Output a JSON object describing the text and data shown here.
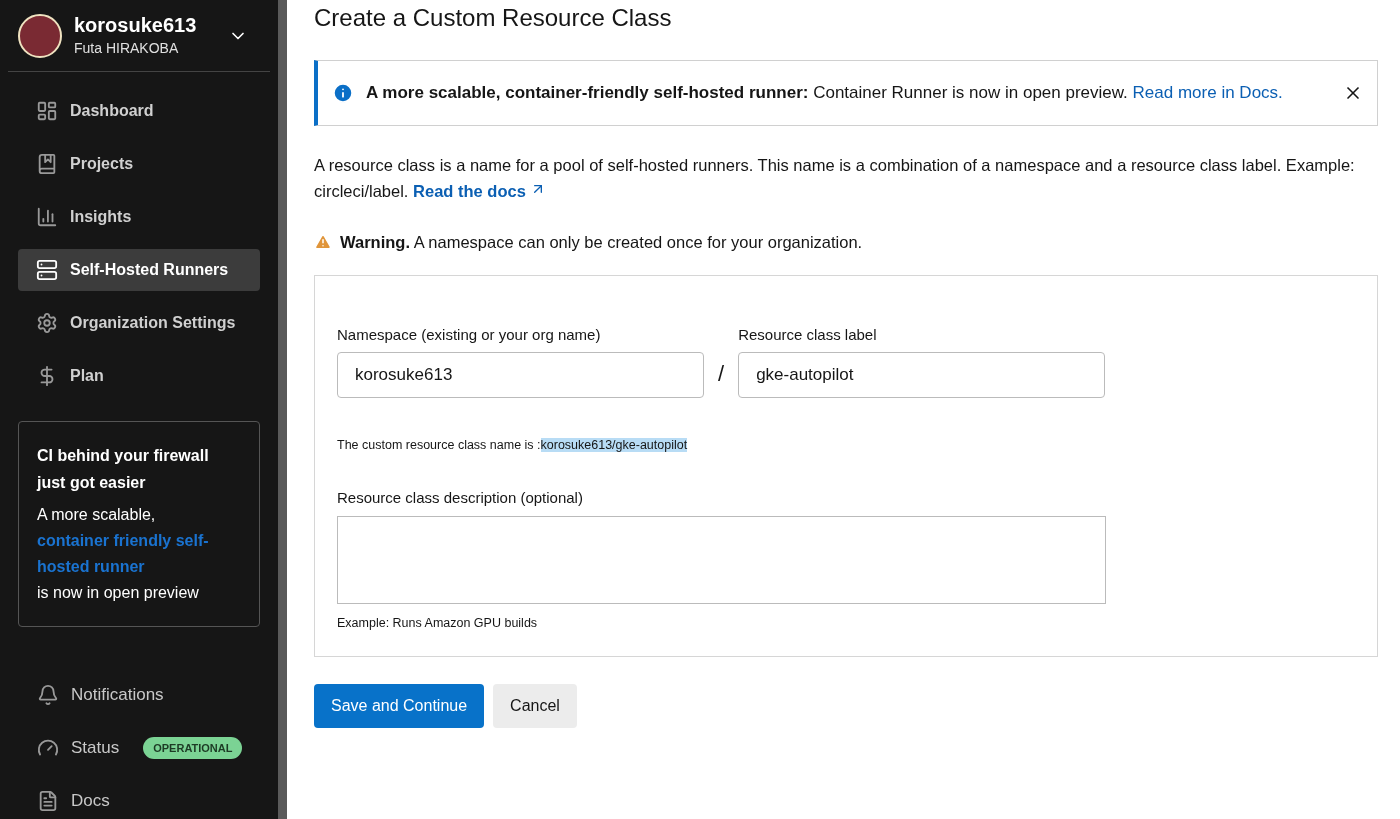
{
  "user": {
    "username": "korosuke613",
    "full_name": "Futa HIRAKOBA"
  },
  "nav": [
    {
      "label": "Dashboard",
      "selected": false
    },
    {
      "label": "Projects",
      "selected": false
    },
    {
      "label": "Insights",
      "selected": false
    },
    {
      "label": "Self-Hosted Runners",
      "selected": true
    },
    {
      "label": "Organization Settings",
      "selected": false
    },
    {
      "label": "Plan",
      "selected": false
    }
  ],
  "promo": {
    "title": "CI behind your firewall just got easier",
    "text_before": "A more scalable,",
    "link": "container friendly self-hosted runner",
    "text_after": "is now in open preview"
  },
  "footer_nav": [
    {
      "label": "Notifications"
    },
    {
      "label": "Status",
      "badge": "OPERATIONAL"
    },
    {
      "label": "Docs"
    }
  ],
  "page_title": "Create a Custom Resource Class",
  "banner": {
    "bold": "A more scalable, container-friendly self-hosted runner:",
    "text": "Container Runner is now in open preview.",
    "link": "Read more in Docs."
  },
  "intro": {
    "text": "A resource class is a name for a pool of self-hosted runners. This name is a combination of a namespace and a resource class label. Example: circleci/label.",
    "link": "Read the docs"
  },
  "warning": {
    "bold": "Warning.",
    "text": "A namespace can only be created once for your organization."
  },
  "form": {
    "namespace_label": "Namespace (existing or your org name)",
    "namespace_value": "korosuke613",
    "separator": "/",
    "class_label": "Resource class label",
    "class_value": "gke-autopilot",
    "preview_prefix": "The custom resource class name is :",
    "preview_value": "korosuke613/gke-autopilot",
    "description_label": "Resource class description (optional)",
    "description_hint": "Example: Runs Amazon GPU builds"
  },
  "buttons": [
    {
      "label": "Save and Continue",
      "kind": "primary"
    },
    {
      "label": "Cancel",
      "kind": "secondary"
    }
  ]
}
